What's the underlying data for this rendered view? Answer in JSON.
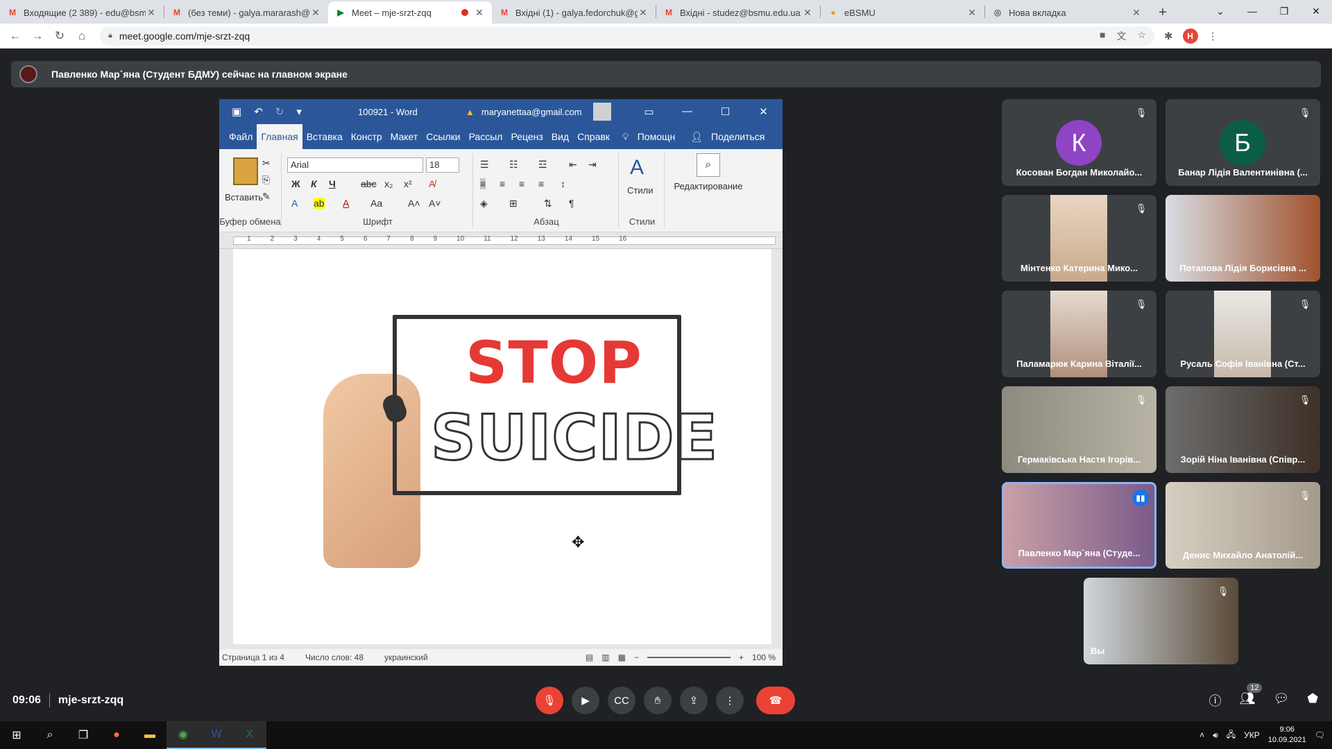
{
  "browser": {
    "tabs": [
      {
        "icon": "gmail-icon",
        "title": "Входящие (2 389) - edu@bsmu.",
        "active": false
      },
      {
        "icon": "gmail-icon",
        "title": "(без теми) - galya.mararash@bs",
        "active": false
      },
      {
        "icon": "meet-icon",
        "title": "Meet – mje-srzt-zqq",
        "active": true
      },
      {
        "icon": "gmail-icon",
        "title": "Вхідні (1) - galya.fedorchuk@gm",
        "active": false
      },
      {
        "icon": "gmail-icon",
        "title": "Вхідні - studez@bsmu.edu.ua -",
        "active": false
      },
      {
        "icon": "ebsmu-icon",
        "title": "eBSMU",
        "active": false
      },
      {
        "icon": "chrome-icon",
        "title": "Нова вкладка",
        "active": false
      }
    ],
    "url": "meet.google.com/mje-srzt-zqq",
    "profile_initial": "H"
  },
  "banner": {
    "text": "Павленко Мар`яна (Студент БДМУ) сейчас на главном экране"
  },
  "word": {
    "doc_title": "100921 - Word",
    "user_email": "maryanettaa@gmail.com",
    "menu_tabs": [
      "Файл",
      "Главная",
      "Вставка",
      "Констр",
      "Макет",
      "Ссылки",
      "Рассыл",
      "Реценз",
      "Вид",
      "Справк"
    ],
    "active_tab": "Главная",
    "help_label": "Помощн",
    "share_label": "Поделиться",
    "paste_label": "Вставить",
    "font_name": "Arial",
    "font_size": "18",
    "styles_label": "Стили",
    "editing_label": "Редактирование",
    "groups": {
      "clipboard": "Буфер обмена",
      "font": "Шрифт",
      "paragraph": "Абзац",
      "styles": "Стили"
    },
    "ruler_numbers": [
      "1",
      "2",
      "3",
      "4",
      "5",
      "6",
      "7",
      "8",
      "9",
      "10",
      "11",
      "12",
      "13",
      "14",
      "15",
      "16"
    ],
    "image_text": {
      "line1": "STOP",
      "line2": "SUICIDE"
    },
    "status": {
      "page": "Страница 1 из 4",
      "words": "Число слов: 48",
      "lang": "украинский",
      "zoom": "100 %"
    }
  },
  "participants": [
    {
      "name": "Косован Богдан Миколайо...",
      "initial": "К",
      "color": "#8e44c4",
      "muted": true
    },
    {
      "name": "Банар Лідія Валентинівна (...",
      "initial": "Б",
      "color": "#0b5e45",
      "muted": true
    },
    {
      "name": "Мінтенко Катерина Мико...",
      "muted": true
    },
    {
      "name": "Потапова Лідія Борисівна ...",
      "muted": false
    },
    {
      "name": "Паламарюк Карина Віталії...",
      "muted": true
    },
    {
      "name": "Русаль Софія Іванівна (Ст...",
      "muted": true
    },
    {
      "name": "Гермаківська Настя Ігорів...",
      "muted": true
    },
    {
      "name": "Зорій Ніна Іванівна (Співр...",
      "muted": true
    },
    {
      "name": "Павленко Мар`яна (Студе...",
      "muted": false,
      "speaking": true
    },
    {
      "name": "Денис Михайло Анатолій...",
      "muted": true
    },
    {
      "name": "Вы",
      "muted": true
    }
  ],
  "meeting": {
    "time": "09:06",
    "code": "mje-srzt-zqq",
    "people_count": "12"
  },
  "taskbar": {
    "time": "9:06",
    "date": "10.09.2021",
    "lang": "УКР"
  }
}
